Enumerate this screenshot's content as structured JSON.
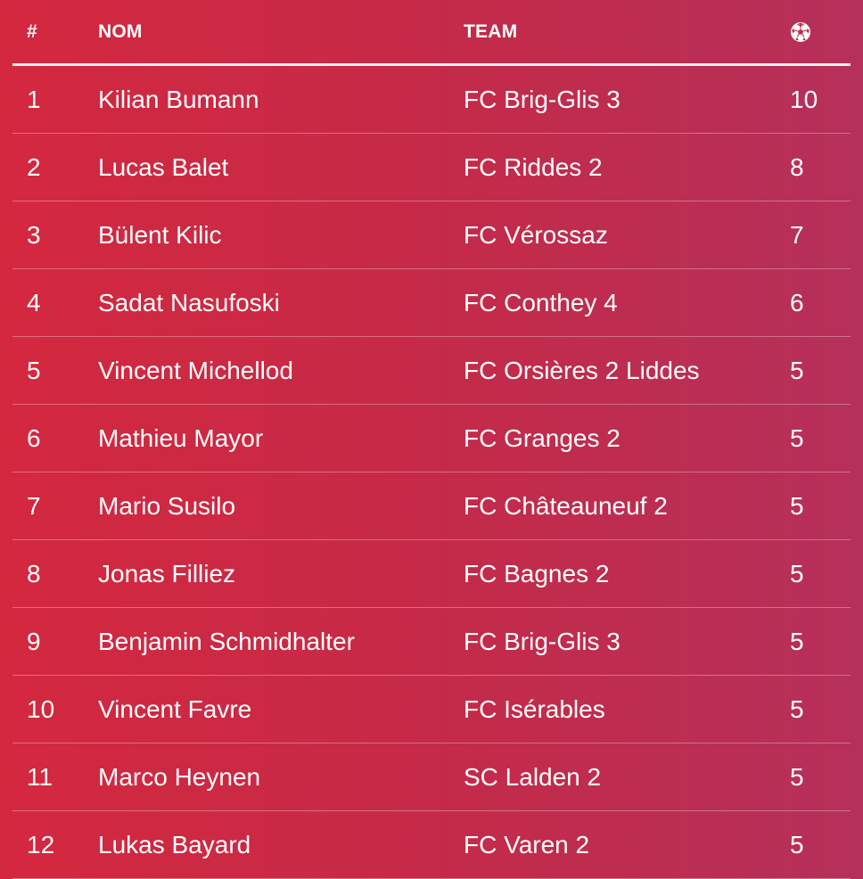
{
  "table": {
    "headers": {
      "rank": "#",
      "name": "NOM",
      "team": "TEAM",
      "goals_icon": "soccer-ball-icon"
    },
    "rows": [
      {
        "rank": "1",
        "name": "Kilian Bumann",
        "team": "FC Brig-Glis 3",
        "goals": "10"
      },
      {
        "rank": "2",
        "name": "Lucas Balet",
        "team": "FC Riddes 2",
        "goals": "8"
      },
      {
        "rank": "3",
        "name": "Bülent Kilic",
        "team": "FC Vérossaz",
        "goals": "7"
      },
      {
        "rank": "4",
        "name": "Sadat Nasufoski",
        "team": "FC Conthey 4",
        "goals": "6"
      },
      {
        "rank": "5",
        "name": "Vincent Michellod",
        "team": "FC Orsières 2 Liddes",
        "goals": "5"
      },
      {
        "rank": "6",
        "name": "Mathieu Mayor",
        "team": "FC Granges 2",
        "goals": "5"
      },
      {
        "rank": "7",
        "name": "Mario Susilo",
        "team": "FC Châteauneuf 2",
        "goals": "5"
      },
      {
        "rank": "8",
        "name": "Jonas Filliez",
        "team": "FC Bagnes 2",
        "goals": "5"
      },
      {
        "rank": "9",
        "name": "Benjamin Schmidhalter",
        "team": "FC Brig-Glis 3",
        "goals": "5"
      },
      {
        "rank": "10",
        "name": "Vincent Favre",
        "team": "FC Isérables",
        "goals": "5"
      },
      {
        "rank": "11",
        "name": "Marco Heynen",
        "team": "SC Lalden 2",
        "goals": "5"
      },
      {
        "rank": "12",
        "name": "Lukas Bayard",
        "team": "FC Varen 2",
        "goals": "5"
      }
    ]
  },
  "colors": {
    "background_left": "#d4283f",
    "background_right": "#b5305a",
    "text": "#ffffff"
  }
}
